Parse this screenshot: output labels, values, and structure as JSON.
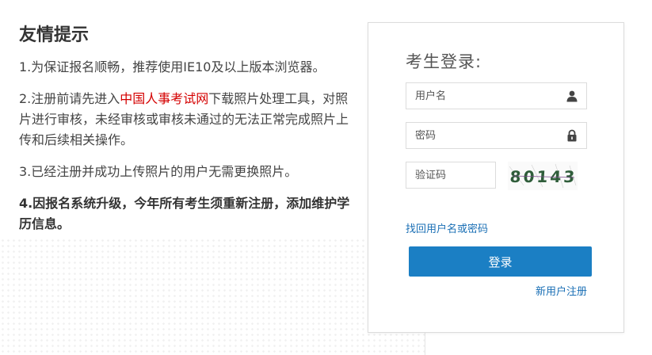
{
  "notice": {
    "title": "友情提示",
    "item1": "1.为保证报名顺畅，推荐使用IE10及以上版本浏览器。",
    "item2_before": "2.注册前请先进入",
    "item2_link": "中国人事考试网",
    "item2_after": "下载照片处理工具，对照片进行审核，未经审核或审核未通过的无法正常完成照片上传和后续相关操作。",
    "item3": "3.已经注册并成功上传照片的用户无需更换照片。",
    "item4": "4.因报名系统升级，今年所有考生须重新注册，添加维护学历信息。"
  },
  "login": {
    "title": "考生登录:",
    "username_placeholder": "用户名",
    "username_icon": "user-icon",
    "password_placeholder": "密码",
    "password_icon": "lock-icon",
    "captcha_placeholder": "验证码",
    "captcha_text": "80143",
    "forgot_link": "找回用户名或密码",
    "submit_label": "登录",
    "register_link": "新用户注册"
  },
  "colors": {
    "accent": "#1b7fc4",
    "link": "#1a6fb5",
    "highlight": "#d40000"
  }
}
